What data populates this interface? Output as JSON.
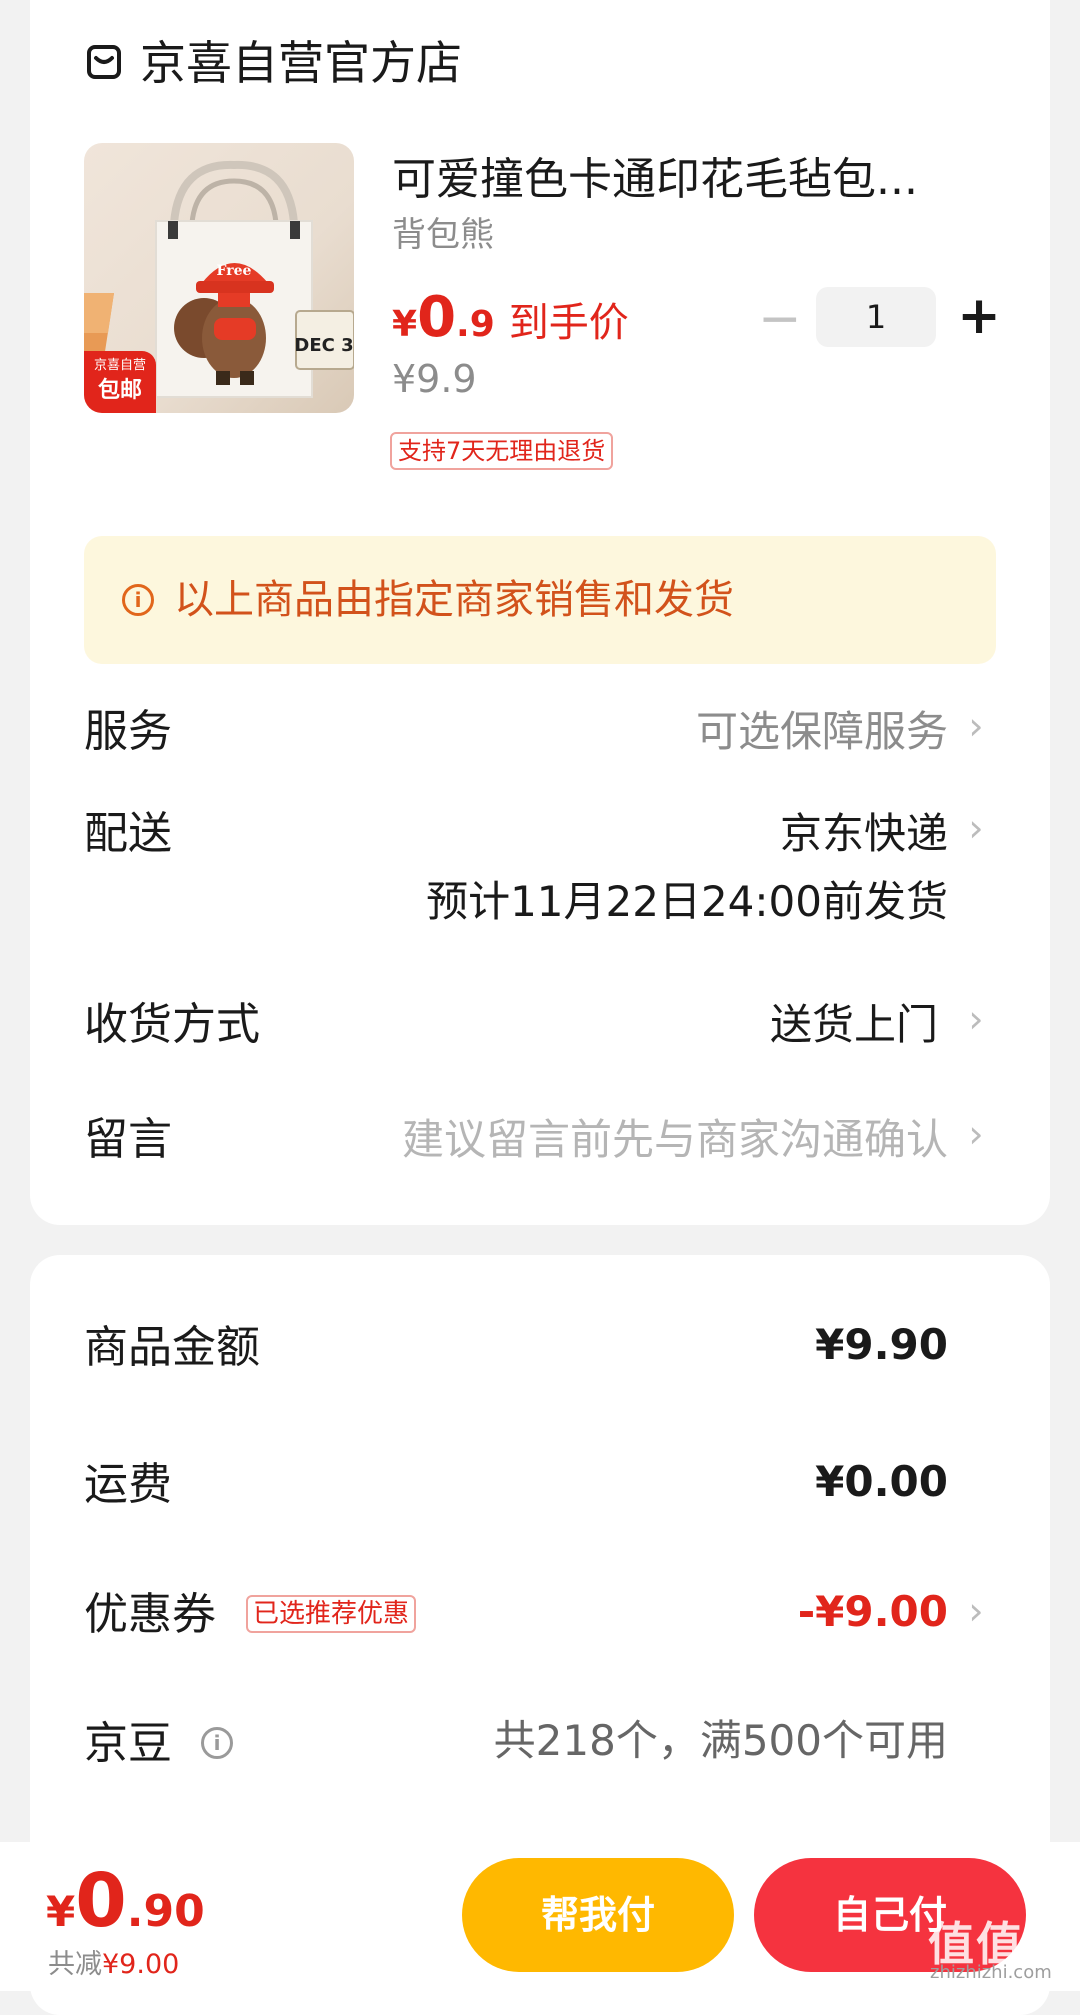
{
  "store": {
    "name": "京喜自营官方店"
  },
  "product": {
    "title": "可爱撞色卡通印花毛毡包...",
    "shop": "背包熊",
    "price_currency": "¥",
    "price_integer": "0",
    "price_decimal": ".9",
    "price_tag": "到手价",
    "original_price": "¥9.9",
    "return_policy": "支持7天无理由退货",
    "quantity": "1",
    "thumb_badge_line1": "京喜自营",
    "thumb_badge_line2": "包邮",
    "thumb_hat_text": "Free",
    "thumb_calendar_text": "DEC 3"
  },
  "notice": {
    "text": "以上商品由指定商家销售和发货"
  },
  "rows": {
    "service_label": "服务",
    "service_value": "可选保障服务",
    "delivery_label": "配送",
    "delivery_value": "京东快递",
    "delivery_eta": "预计11月22日24:00前发货",
    "receive_label": "收货方式",
    "receive_value": "送货上门",
    "message_label": "留言",
    "message_placeholder": "建议留言前先与商家沟通确认"
  },
  "summary": {
    "goods_label": "商品金额",
    "goods_value": "¥9.90",
    "shipping_label": "运费",
    "shipping_value": "¥0.00",
    "coupon_label": "优惠券",
    "coupon_tag": "已选推荐优惠",
    "coupon_value": "-¥9.00",
    "beans_label": "京豆",
    "beans_value": "共218个，满500个可用"
  },
  "footer": {
    "total_currency": "¥",
    "total_integer": "0",
    "total_decimal": ".90",
    "saved_prefix": "共减",
    "saved_amount": "¥9.00",
    "help_pay_label": "帮我付",
    "self_pay_label": "自己付",
    "watermark": "值值值",
    "watermark_url": "zhizhizhi.com"
  },
  "colors": {
    "accent_red": "#e1251b",
    "help_button": "#ffb800",
    "self_button": "#f5333f",
    "notice_bg": "#fdf7dd"
  },
  "icons": [
    "store-icon",
    "info-icon",
    "chevron-right-icon",
    "minus-icon",
    "plus-icon"
  ]
}
